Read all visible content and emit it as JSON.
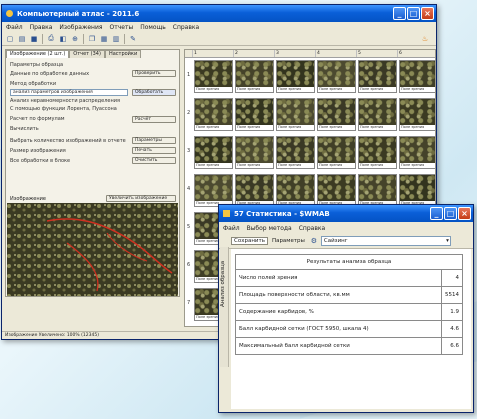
{
  "main_window": {
    "title": "Компьютерный атлас - 2011.6",
    "menu": [
      "Файл",
      "Правка",
      "Изображения",
      "Отчеты",
      "Помощь",
      "Справка"
    ],
    "toolbar_icons": [
      "new-icon",
      "open-icon",
      "save-icon",
      "print-icon",
      "photo-icon",
      "zoom-icon",
      "copy-icon",
      "grid-icon",
      "stats-icon",
      "help-icon"
    ],
    "left_tabs": [
      "Изображение (2 шт.)",
      "Отчет (34)",
      "Настройки"
    ],
    "left_rows": [
      "Параметры образца",
      "Данные по обработке данных",
      "Метод обработки",
      "Анализ неравномерности распределения",
      "С помощью функции Лорента, Пуассона",
      "Расчет по формулам",
      "Вычислить",
      "Выбрать количество изображений в отчете",
      "Размер изображения",
      "Все обработки в блоке"
    ],
    "left_buttons": [
      "Проверить",
      "Обработать",
      "Расчёт",
      "Параметры",
      "Печать",
      "Очистить"
    ],
    "left_input_value": "анализ параметров изображения",
    "preview_label": "Изображение",
    "preview_button": "Увеличить изображение",
    "status_text": "Изображение Увеличено: 100% (12345)",
    "grid_columns": [
      "1",
      "2",
      "3",
      "4",
      "5",
      "6"
    ],
    "grid_rows": [
      "1",
      "2",
      "3",
      "4",
      "5",
      "6",
      "7"
    ],
    "thumbnail_caption": "Поле зрения"
  },
  "stats_window": {
    "title": "57 Статистика - $WMAB",
    "menu": [
      "Файл",
      "Выбор метода",
      "Справка"
    ],
    "toolbar_button1": "Сохранить",
    "toolbar_button2": "Параметры",
    "toolbar_select_value": "Сайзинг",
    "side_caption": "Анализ образца",
    "table_header": "Результаты анализа образца",
    "rows": [
      {
        "label": "Число полей зрения",
        "value": "4"
      },
      {
        "label": "Площадь поверхности области, кв.мм",
        "value": "5514"
      },
      {
        "label": "Содержание карбидов, %",
        "value": "1.9"
      },
      {
        "label": "Балл карбидной сетки (ГОСТ 5950, шкала 4)",
        "value": "4.6"
      },
      {
        "label": "Максимальный балл карбидной сетки",
        "value": "6.6"
      }
    ]
  },
  "colors": {
    "title_blue": "#0a5fd8",
    "window_face": "#ece9d8",
    "close_red": "#c43c17",
    "micro_dark": "#3b3a22",
    "micro_light": "#8a8a55",
    "overlay_red": "#d03020"
  }
}
